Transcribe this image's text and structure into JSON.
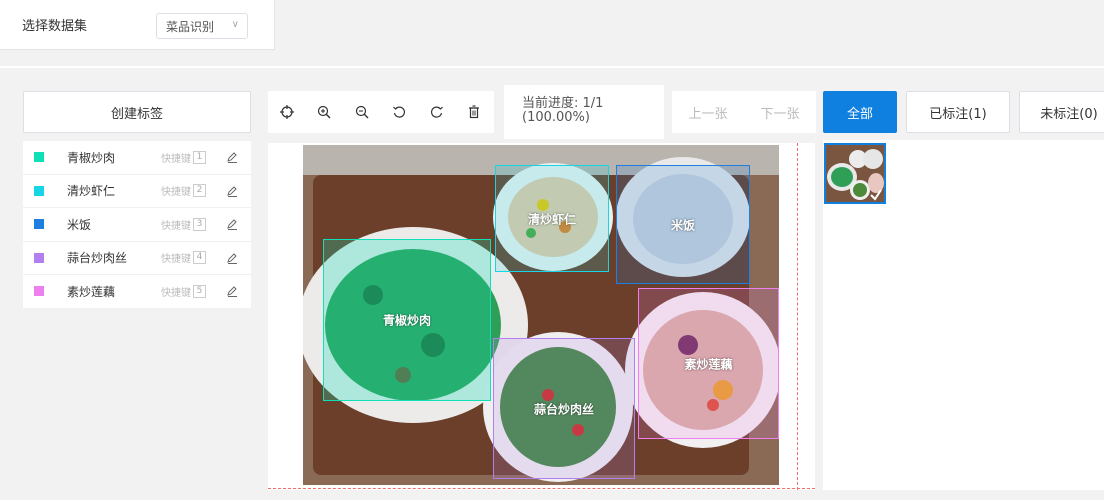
{
  "dataset": {
    "label": "选择数据集",
    "selected": "菜品识别"
  },
  "left_panel": {
    "create_label_button": "创建标签",
    "shortcut_text": "快捷键",
    "labels": [
      {
        "name": "青椒炒肉",
        "color": "#10e0b8",
        "key": "1"
      },
      {
        "name": "清炒虾仁",
        "color": "#16d6e6",
        "key": "2"
      },
      {
        "name": "米饭",
        "color": "#1f7fe0",
        "key": "3"
      },
      {
        "name": "蒜台炒肉丝",
        "color": "#b27ef0",
        "key": "4"
      },
      {
        "name": "素炒莲藕",
        "color": "#ef7fef",
        "key": "5"
      }
    ]
  },
  "toolbar": {
    "icons": [
      "crosshair-icon",
      "zoom-in-icon",
      "zoom-out-icon",
      "rotate-left-icon",
      "rotate-right-icon",
      "trash-icon"
    ]
  },
  "progress": {
    "line1": "当前进度: 1/1",
    "line2": "(100.00%)"
  },
  "nav": {
    "prev": "上一张",
    "next": "下一张"
  },
  "filters": {
    "all": "全部",
    "labeled": "已标注(1)",
    "unlabeled": "未标注(0)"
  },
  "annotations": [
    {
      "label": "青椒炒肉",
      "color": "#10e0b8"
    },
    {
      "label": "清炒虾仁",
      "color": "#16d6e6"
    },
    {
      "label": "米饭",
      "color": "#1f7fe0"
    },
    {
      "label": "素炒莲藕",
      "color": "#ef7fef"
    },
    {
      "label": "蒜台炒肉丝",
      "color": "#b27ef0"
    }
  ],
  "colors": {
    "accent": "#0f7fe0",
    "guide_dashed": "#f26d6d"
  }
}
